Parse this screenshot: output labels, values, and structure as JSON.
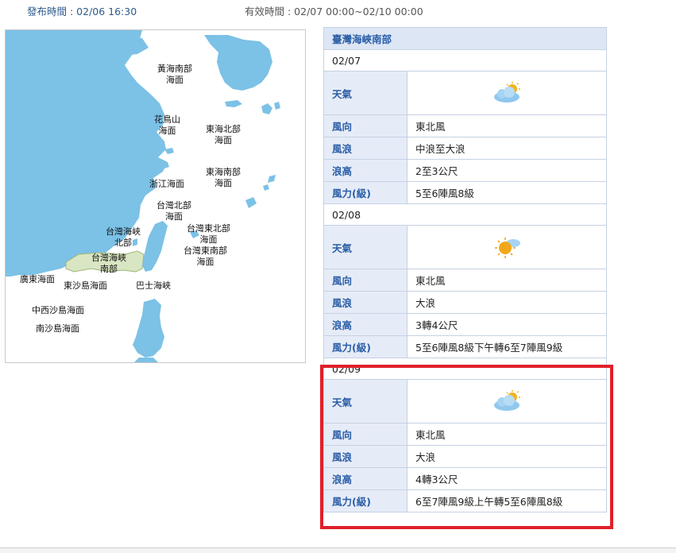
{
  "header": {
    "issued": "發布時間 : 02/06 16:30",
    "valid": "有效時間 : 02/07 00:00~02/10 00:00"
  },
  "map": {
    "labels": {
      "yellow_sea_south": "黃海南部\n海面",
      "huaniao": "花鳥山\n海面",
      "east_sea_north": "東海北部\n海面",
      "east_sea_south": "東海南部\n海面",
      "zhejiang": "浙江海面",
      "taiwan_north": "台灣北部\n海面",
      "strait_north": "台灣海峽\n北部",
      "strait_south": "台灣海峽\n南部",
      "taiwan_northeast": "台灣東北部\n海面",
      "taiwan_southeast": "台灣東南部\n海面",
      "guangdong": "廣東海面",
      "dongsha": "東沙島海面",
      "bashi": "巴士海峽",
      "zhongxisha": "中西沙島海面",
      "nansha": "南沙島海面"
    },
    "colors": {
      "sea": "#ffffff",
      "land": "#7cc1e6",
      "highlight_zone": "#d9e6c3"
    }
  },
  "forecast": {
    "region": "臺灣海峽南部",
    "labels": {
      "weather": "天氣",
      "wind_dir": "風向",
      "waves": "風浪",
      "wave_height": "浪高",
      "wind_force": "風力(級)"
    },
    "days": [
      {
        "date": "02/07",
        "weather_icon": "cloudy-sun-icon",
        "wind_dir": "東北風",
        "waves": "中浪至大浪",
        "wave_height": "2至3公尺",
        "wind_force": "5至6陣風8級"
      },
      {
        "date": "02/08",
        "weather_icon": "sun-cloud-icon",
        "wind_dir": "東北風",
        "waves": "大浪",
        "wave_height": "3轉4公尺",
        "wind_force": "5至6陣風8級下午轉6至7陣風9級"
      },
      {
        "date": "02/09",
        "weather_icon": "cloudy-sun-icon",
        "wind_dir": "東北風",
        "waves": "大浪",
        "wave_height": "4轉3公尺",
        "wind_force": "6至7陣風9級上午轉5至6陣風8級"
      }
    ],
    "highlight_color": "#e0202a"
  }
}
